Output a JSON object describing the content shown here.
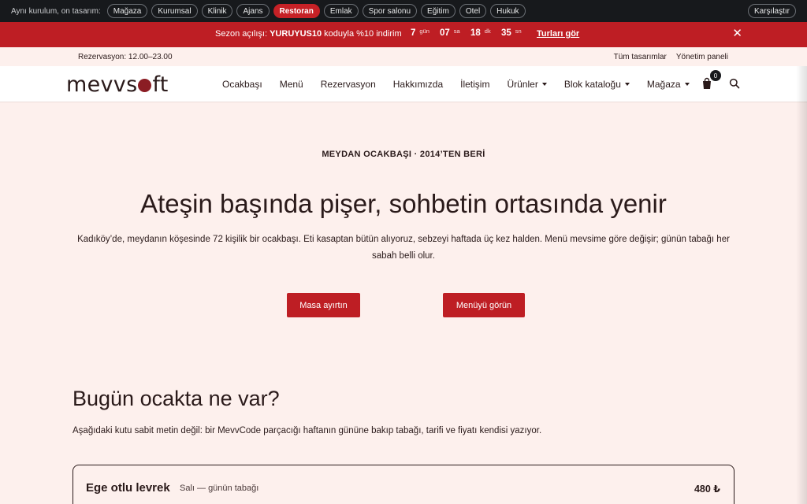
{
  "demo_bar": {
    "label": "Aynı kurulum, on tasarım:",
    "pills": [
      {
        "label": "Mağaza",
        "active": false
      },
      {
        "label": "Kurumsal",
        "active": false
      },
      {
        "label": "Klinik",
        "active": false
      },
      {
        "label": "Ajans",
        "active": false
      },
      {
        "label": "Restoran",
        "active": true
      },
      {
        "label": "Emlak",
        "active": false
      },
      {
        "label": "Spor salonu",
        "active": false
      },
      {
        "label": "Eğitim",
        "active": false
      },
      {
        "label": "Otel",
        "active": false
      },
      {
        "label": "Hukuk",
        "active": false
      }
    ],
    "compare_label": "Karşılaştır"
  },
  "promo": {
    "text_before": "Sezon açılışı: ",
    "code": "YURUYUS10",
    "text_after": " koduyla %10 indirim",
    "countdown": [
      {
        "value": "7",
        "unit": "gün"
      },
      {
        "value": "07",
        "unit": "sa"
      },
      {
        "value": "18",
        "unit": "dk"
      },
      {
        "value": "35",
        "unit": "sn"
      }
    ],
    "link_label": "Turları gör",
    "close_glyph": "✕"
  },
  "utility": {
    "hours": "Rezervasyon: 12.00–23.00",
    "links": [
      "Tüm tasarımlar",
      "Yönetim paneli"
    ]
  },
  "header": {
    "logo_left": "mevvs",
    "logo_right": "ft",
    "nav": [
      {
        "label": "Ocakbaşı",
        "dropdown": false
      },
      {
        "label": "Menü",
        "dropdown": false
      },
      {
        "label": "Rezervasyon",
        "dropdown": false
      },
      {
        "label": "Hakkımızda",
        "dropdown": false
      },
      {
        "label": "İletişim",
        "dropdown": false
      },
      {
        "label": "Ürünler",
        "dropdown": true
      },
      {
        "label": "Blok kataloğu",
        "dropdown": true
      },
      {
        "label": "Mağaza",
        "dropdown": true
      }
    ],
    "cart_count": "0"
  },
  "hero": {
    "eyebrow": "MEYDAN OCAKBAŞI · 2014’TEN BERİ",
    "title": "Ateşin başında pişer, sohbetin ortasında yenir",
    "description": "Kadıköy’de, meydanın köşesinde 72 kişilik bir ocakbaşı. Eti kasaptan bütün alıyoruz, sebzeyi haftada üç kez halden. Menü mevsime göre değişir; günün tabağı her sabah belli olur.",
    "primary_button": "Masa ayırtın",
    "secondary_button": "Menüyü görün"
  },
  "daily": {
    "title": "Bugün ocakta ne var?",
    "description": "Aşağıdaki kutu sabit metin değil: bir MevvCode parçacığı haftanın gününe bakıp tabağı, tarifi ve fiyatı kendisi yazıyor.",
    "dish_name": "Ege otlu levrek",
    "dish_sub": "Salı — günün tabağı",
    "dish_price": "480 ₺"
  }
}
